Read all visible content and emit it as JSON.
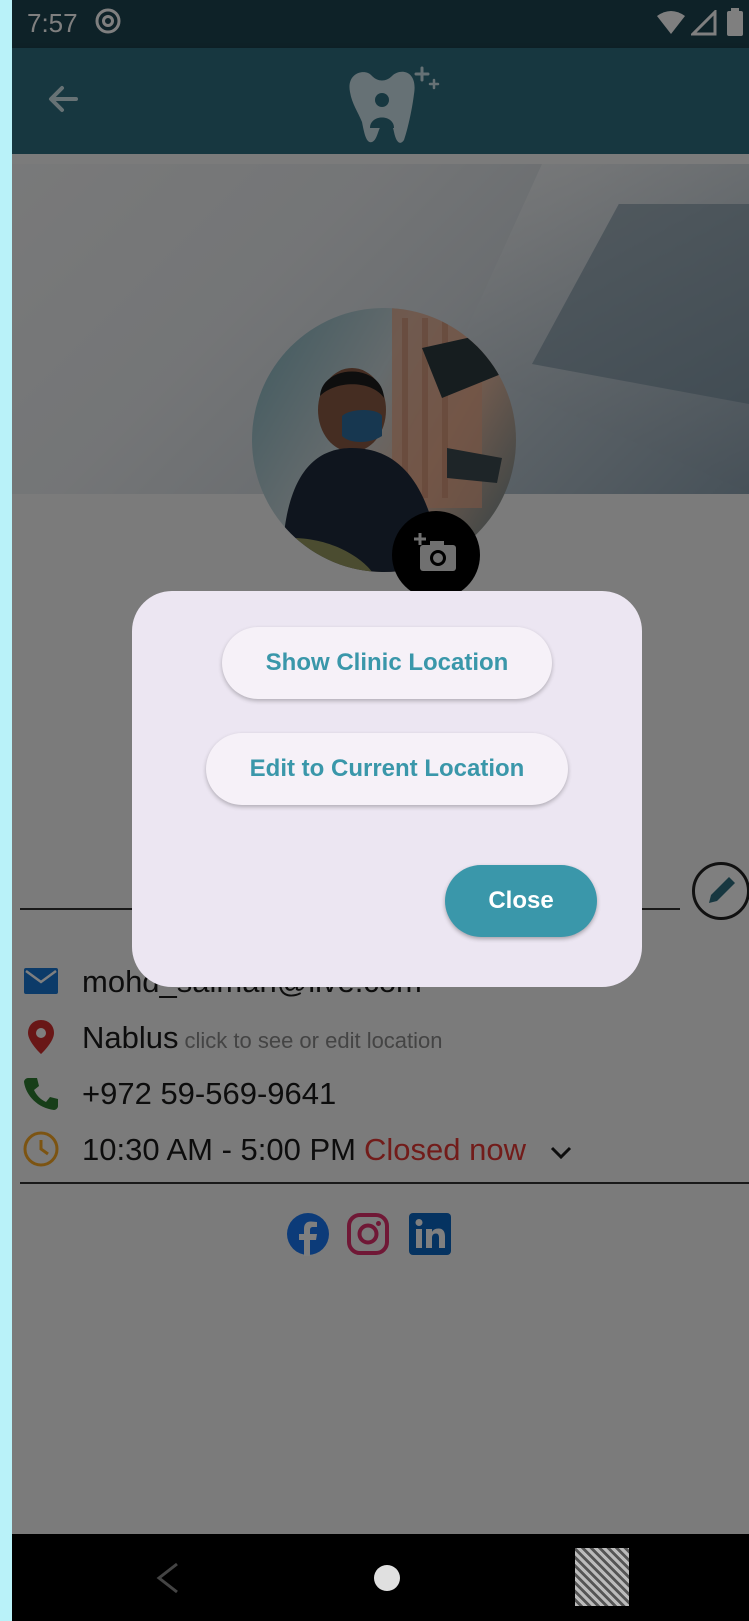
{
  "status_bar": {
    "time": "7:57",
    "at_icon": "at-sign-icon",
    "wifi_icon": "wifi-icon",
    "signal_icon": "signal-icon",
    "battery_icon": "battery-icon"
  },
  "app_bar": {
    "back_icon": "arrow-back-icon",
    "logo": "dental-clinic-logo"
  },
  "profile": {
    "email": "mohd_salman@live.com",
    "location": "Nablus",
    "location_hint": "click to see or edit location",
    "phone": "+972 59-569-9641",
    "hours": "10:30 AM - 5:00 PM",
    "status": "Closed now"
  },
  "dialog": {
    "show_location": "Show Clinic Location",
    "edit_location": "Edit to Current Location",
    "close": "Close"
  },
  "colors": {
    "app_bar": "#2f6f80",
    "accent": "#3a97aa",
    "closed": "#e53935",
    "facebook": "#1877f2",
    "instagram": "#e1306c",
    "linkedin": "#0a66c2"
  },
  "nav_bar": {
    "back_icon": "nav-back-icon",
    "home_icon": "nav-home-icon",
    "recents_icon": "nav-recents-icon"
  }
}
